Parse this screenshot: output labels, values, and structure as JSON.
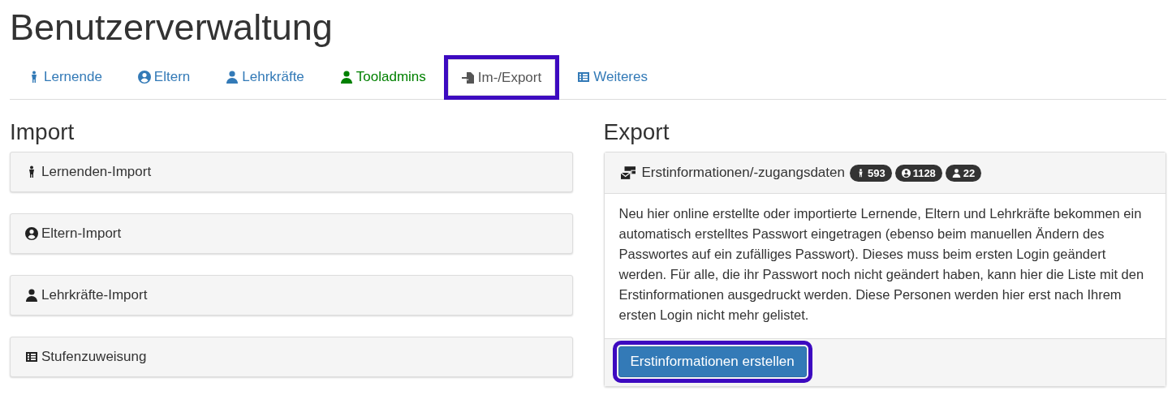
{
  "title": "Benutzerverwaltung",
  "tabs": [
    {
      "label": "Lernende",
      "kind": "child",
      "selected": false,
      "color": "#337ab7",
      "highlighted": false
    },
    {
      "label": "Eltern",
      "kind": "usercircle",
      "selected": false,
      "color": "#337ab7",
      "highlighted": false
    },
    {
      "label": "Lehrkräfte",
      "kind": "user",
      "selected": false,
      "color": "#337ab7",
      "highlighted": false
    },
    {
      "label": "Tooladmins",
      "kind": "user",
      "selected": false,
      "color": "#008000",
      "highlighted": false
    },
    {
      "label": "Im-/Export",
      "kind": "import",
      "selected": true,
      "color": "#555555",
      "highlighted": true
    },
    {
      "label": "Weiteres",
      "kind": "table",
      "selected": false,
      "color": "#337ab7",
      "highlighted": false
    }
  ],
  "import": {
    "heading": "Import",
    "panels": [
      {
        "label": "Lernenden-Import",
        "kind": "child"
      },
      {
        "label": "Eltern-Import",
        "kind": "usercircle"
      },
      {
        "label": "Lehrkräfte-Import",
        "kind": "user"
      },
      {
        "label": "Stufenzuweisung",
        "kind": "table"
      }
    ]
  },
  "export": {
    "heading": "Export",
    "card": {
      "title": "Erstinformationen/-zugangsdaten",
      "badges": [
        {
          "kind": "child",
          "count": "593"
        },
        {
          "kind": "usercircle",
          "count": "1128"
        },
        {
          "kind": "user",
          "count": "22"
        }
      ],
      "text": "Neu hier online erstellte oder importierte Lernende, Eltern und Lehrkräfte bekommen ein automatisch erstelltes Passwort eingetragen (ebenso beim manuellen Ändern des Passwortes auf ein zufälliges Passwort). Dieses muss beim ersten Login geändert werden. Für alle, die ihr Passwort noch nicht geändert haben, kann hier die Liste mit den Erstinformationen ausgedruckt werden. Diese Personen werden hier erst nach Ihrem ersten Login nicht mehr gelistet.",
      "button": {
        "label": "Erstinformationen erstellen",
        "highlighted": true
      }
    }
  }
}
